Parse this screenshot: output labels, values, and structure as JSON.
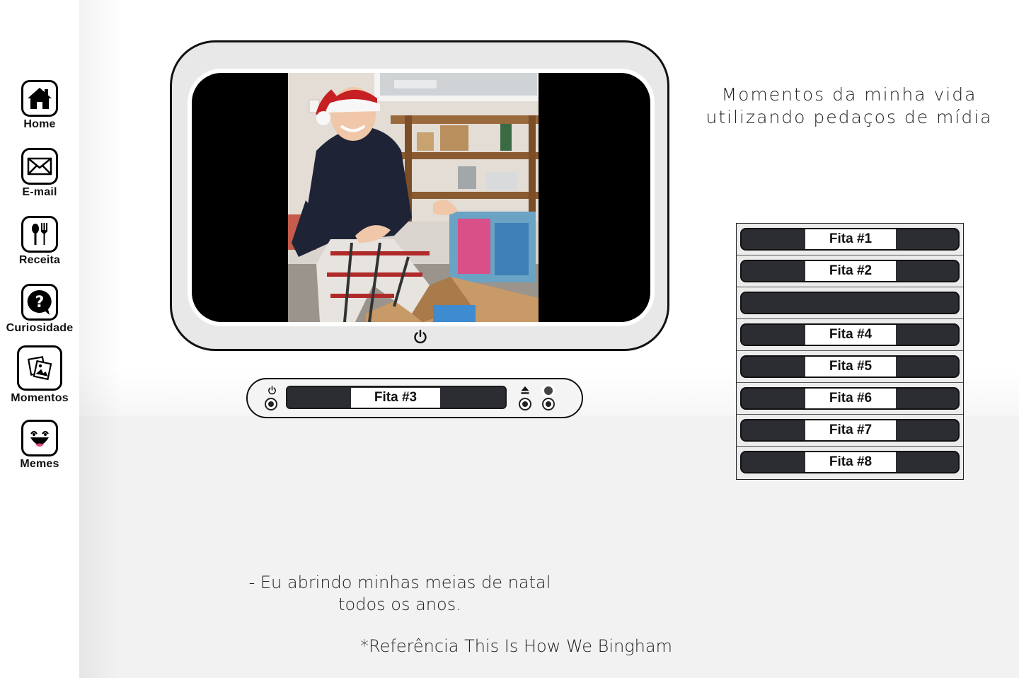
{
  "nav": {
    "home": "Home",
    "email": "E-mail",
    "recipe": "Receita",
    "curiosity": "Curiosidade",
    "moments": "Momentos",
    "memes": "Memes"
  },
  "headline": {
    "line1": "Momentos da minha vida",
    "line2": "utilizando pedaços de mídia"
  },
  "vcr": {
    "current_tape": "Fita #3"
  },
  "rack": {
    "tapes": [
      "Fita #1",
      "Fita #2",
      "",
      "Fita #4",
      "Fita #5",
      "Fita #6",
      "Fita #7",
      "Fita #8"
    ]
  },
  "caption": {
    "line1": "- Eu abrindo minhas meias de natal",
    "line2": "todos os anos."
  },
  "reference": "*Referência This Is How We Bingham"
}
